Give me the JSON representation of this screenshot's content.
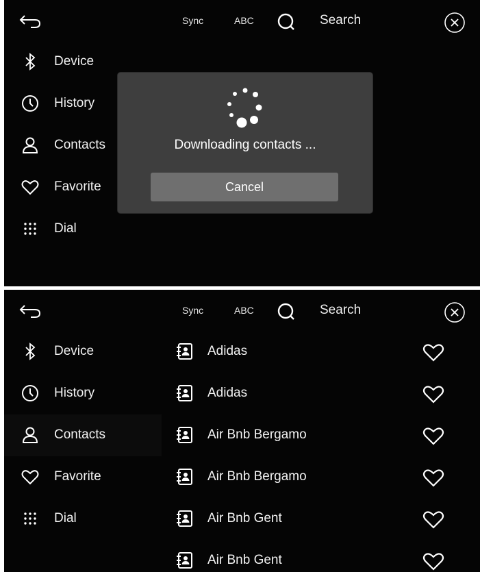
{
  "topbar": {
    "sync_label": "Sync",
    "abc_label": "ABC",
    "search_label": "Search",
    "icons": {
      "back": "back-arrow-icon",
      "search": "search-icon",
      "close": "close-circle-icon"
    }
  },
  "sidebar": {
    "items": [
      {
        "label": "Device",
        "icon": "bluetooth-icon"
      },
      {
        "label": "History",
        "icon": "clock-icon"
      },
      {
        "label": "Contacts",
        "icon": "person-icon"
      },
      {
        "label": "Favorite",
        "icon": "heart-icon"
      },
      {
        "label": "Dial",
        "icon": "keypad-icon"
      }
    ],
    "active_item": "Contacts"
  },
  "dialog": {
    "message": "Downloading contacts ...",
    "cancel_label": "Cancel"
  },
  "contacts": [
    {
      "name": "Adidas"
    },
    {
      "name": "Adidas"
    },
    {
      "name": "Air Bnb Bergamo"
    },
    {
      "name": "Air Bnb Bergamo"
    },
    {
      "name": "Air Bnb Gent"
    },
    {
      "name": "Air Bnb Gent"
    }
  ],
  "colors": {
    "background": "#050505",
    "dialog": "#3e3e3e",
    "cancel_button": "#6f6f6f",
    "text": "#ffffff"
  }
}
